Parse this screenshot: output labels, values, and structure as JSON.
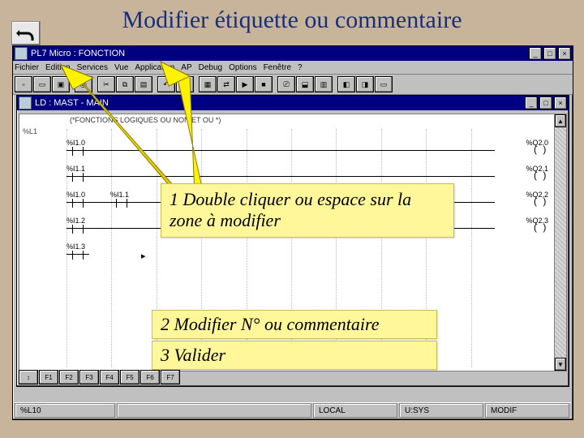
{
  "title": "Modifier étiquette ou commentaire",
  "back_icon": "u-turn-left-icon",
  "app": {
    "title": "PL7 Micro : FONCTION",
    "menu": [
      "Fichier",
      "Edition",
      "Services",
      "Vue",
      "Application",
      "AP",
      "Debug",
      "Options",
      "Fenêtre",
      "?"
    ]
  },
  "mdi": {
    "title": "LD : MAST - MAIN",
    "comment": "(*FONCTIONS LOGIQUES OU  NON  ET  OU *)",
    "rung_label": "%L1",
    "contacts": [
      "%I1.0",
      "%I1.1",
      "%I1.0",
      "%I1.1",
      "%I1.2",
      "%I1.3"
    ],
    "coils": [
      "%Q2.0",
      "%Q2.1",
      "%Q2.2",
      "%Q2.3"
    ],
    "cursor": "▸"
  },
  "notes": {
    "n1": " 1 Double cliquer ou espace sur la zone à modifier",
    "n2": "2 Modifier N° ou commentaire",
    "n3": "3 Valider"
  },
  "status": {
    "cell1": "%L10",
    "cell2": "LOCAL",
    "cell3": "U:SYS",
    "cell4": "MODIF"
  }
}
